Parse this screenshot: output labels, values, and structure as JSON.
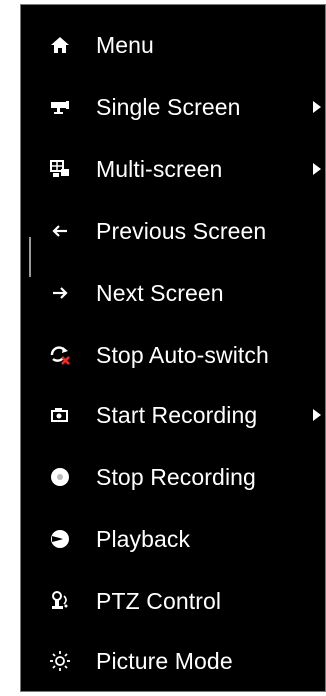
{
  "menu": {
    "items": [
      {
        "label": "Menu",
        "icon": "home-icon",
        "submenu": false
      },
      {
        "label": "Single Screen",
        "icon": "camera-icon",
        "submenu": true
      },
      {
        "label": "Multi-screen",
        "icon": "multi-screen-icon",
        "submenu": true
      },
      {
        "label": "Previous Screen",
        "icon": "arrow-left-icon",
        "submenu": false
      },
      {
        "label": "Next Screen",
        "icon": "arrow-right-icon",
        "submenu": false
      },
      {
        "label": "Stop Auto-switch",
        "icon": "stop-auto-switch-icon",
        "submenu": false
      },
      {
        "label": "Start Recording",
        "icon": "recording-icon",
        "submenu": true
      },
      {
        "label": "Stop Recording",
        "icon": "stop-recording-icon",
        "submenu": false
      },
      {
        "label": "Playback",
        "icon": "playback-icon",
        "submenu": false
      },
      {
        "label": "PTZ Control",
        "icon": "ptz-icon",
        "submenu": false
      },
      {
        "label": "Picture Mode",
        "icon": "picture-mode-icon",
        "submenu": false
      }
    ]
  },
  "colors": {
    "background": "#000000",
    "text": "#ffffff",
    "accent_red": "#e8302a"
  }
}
